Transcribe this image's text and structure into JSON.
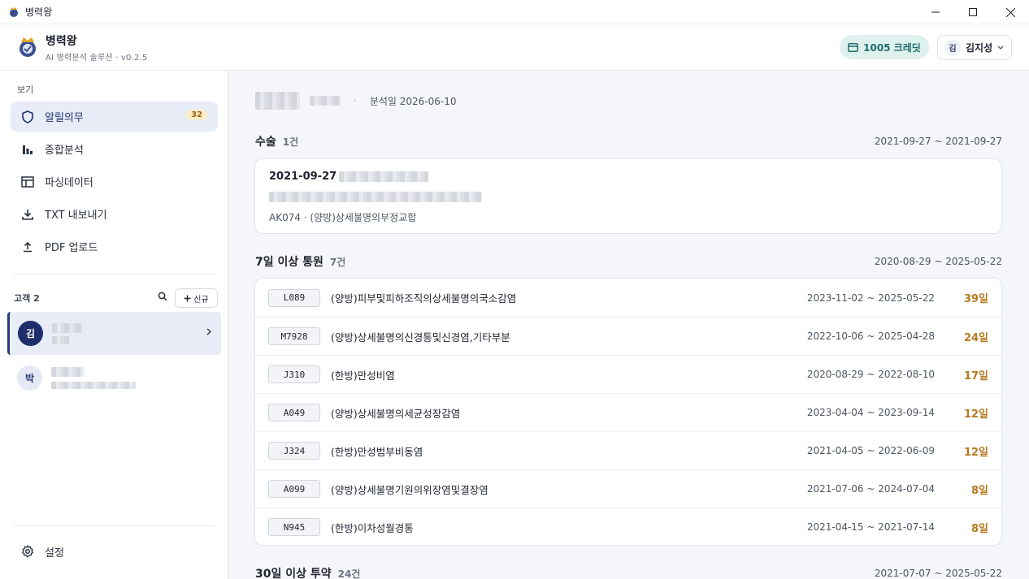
{
  "window": {
    "title": "병력왕",
    "controls": [
      "minimize",
      "maximize",
      "close"
    ]
  },
  "header": {
    "brand_name": "병력왕",
    "brand_sub": "AI 병력분석 솔루션 · v0.2.5",
    "credit": "1005 크레딧",
    "user_initial": "김",
    "user_name": "김지성"
  },
  "sidebar": {
    "section_label": "보기",
    "nav": [
      {
        "label": "알릴의무",
        "badge": "32",
        "icon": "shield-icon",
        "active": true
      },
      {
        "label": "종합분석",
        "icon": "bar-chart-icon"
      },
      {
        "label": "파싱데이터",
        "icon": "table-icon"
      },
      {
        "label": "TXT 내보내기",
        "icon": "download-icon"
      },
      {
        "label": "PDF 업로드",
        "icon": "upload-icon"
      }
    ],
    "customers_label": "고객 2",
    "new_label": "신규",
    "customers": [
      {
        "initial": "김"
      },
      {
        "initial": "박"
      }
    ],
    "settings_label": "설정"
  },
  "main": {
    "analysis_date": "분석일 2026-06-10",
    "surgery": {
      "title": "수술",
      "count": "1건",
      "range": "2021-09-27 ~ 2021-09-27",
      "date": "2021-09-27",
      "code_line": "AK074 · (양방)상세불명의부정교합"
    },
    "hospital": {
      "title": "7일 이상 통원",
      "count": "7건",
      "range": "2020-08-29 ~ 2025-05-22",
      "rows": [
        {
          "code": "L089",
          "name": "(양방)피부및피하조직의상세불명의국소감염",
          "range": "2023-11-02 ~ 2025-05-22",
          "days": "39일"
        },
        {
          "code": "M7928",
          "name": "(양방)상세불명의신경통및신경염,기타부분",
          "range": "2022-10-06 ~ 2025-04-28",
          "days": "24일"
        },
        {
          "code": "J310",
          "name": "(한방)만성비염",
          "range": "2020-08-29 ~ 2022-08-10",
          "days": "17일"
        },
        {
          "code": "A049",
          "name": "(양방)상세불명의세균성장감염",
          "range": "2023-04-04 ~ 2023-09-14",
          "days": "12일"
        },
        {
          "code": "J324",
          "name": "(한방)만성범부비동염",
          "range": "2021-04-05 ~ 2022-06-09",
          "days": "12일"
        },
        {
          "code": "A099",
          "name": "(양방)상세불명기원의위장염및결장염",
          "range": "2021-07-06 ~ 2024-07-04",
          "days": "8일"
        },
        {
          "code": "N945",
          "name": "(한방)이차성월경통",
          "range": "2021-04-15 ~ 2021-07-14",
          "days": "8일"
        }
      ]
    },
    "medication": {
      "title": "30일 이상 투약",
      "count": "24건",
      "range": "2021-07-07 ~ 2025-05-22"
    }
  }
}
